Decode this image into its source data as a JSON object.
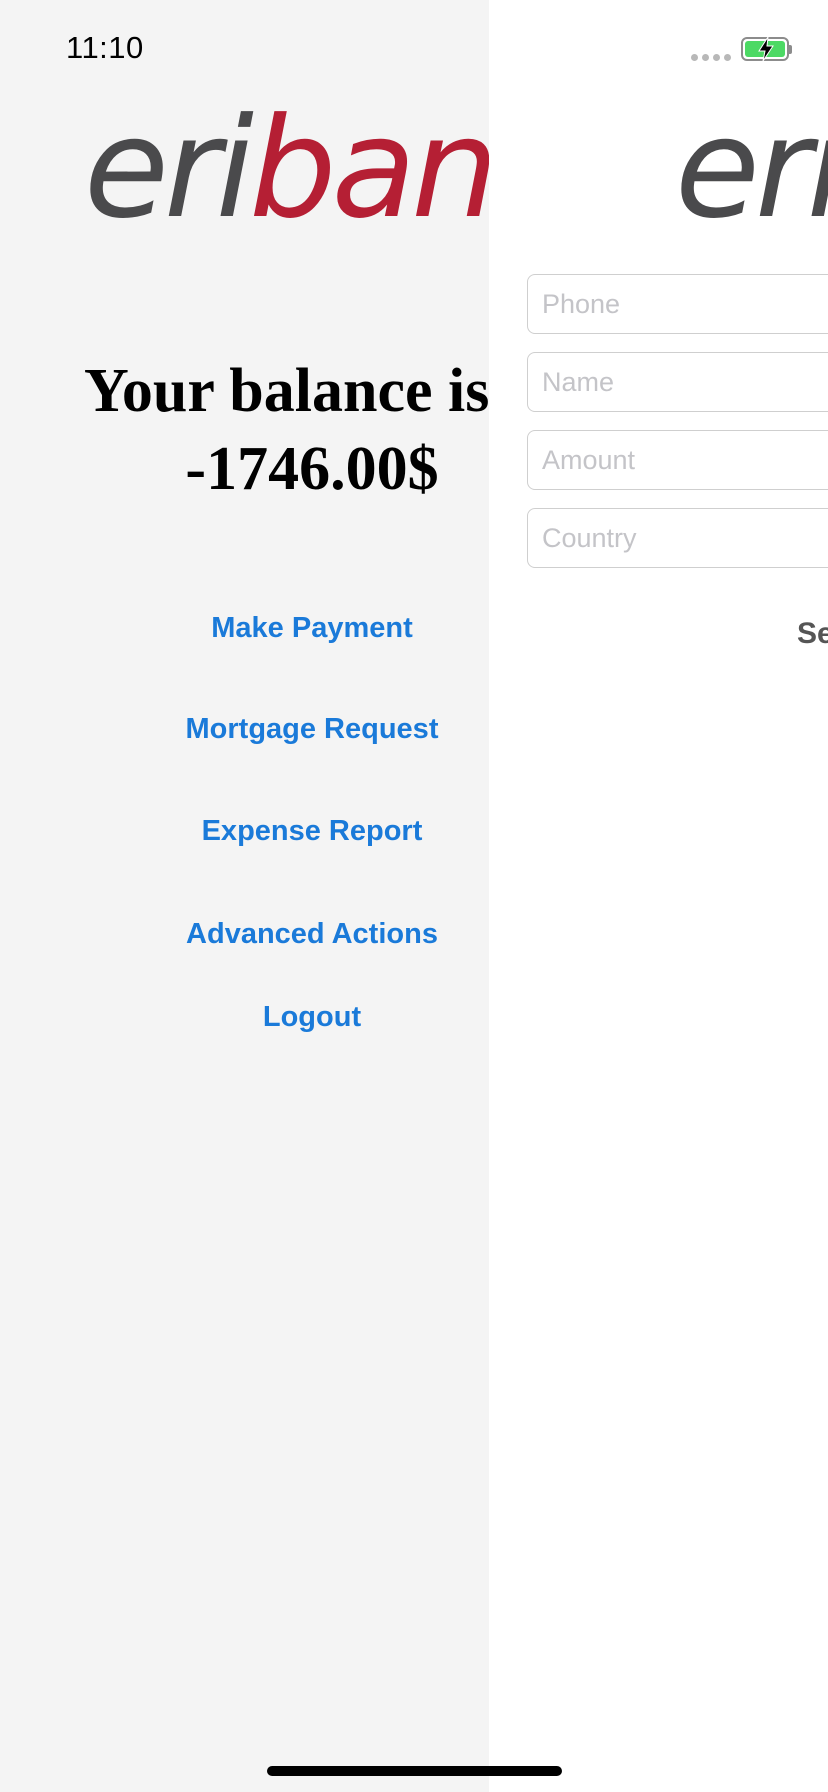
{
  "status_bar": {
    "time": "11:10",
    "battery_state": "charging",
    "battery_color": "#4cd964"
  },
  "brand": {
    "logo_part1": "eri",
    "logo_part2": "bank",
    "logo_color_gray": "#4a4a4c",
    "logo_color_red": "#b51f34"
  },
  "home": {
    "balance_label": "Your balance is",
    "balance_value": "-1746.00$",
    "menu_items": [
      "Make Payment",
      "Mortgage Request",
      "Expense Report",
      "Advanced Actions",
      "Logout"
    ],
    "link_color": "#1a7ad9"
  },
  "payment_form": {
    "phone_placeholder": "Phone",
    "name_placeholder": "Name",
    "amount_placeholder": "Amount",
    "country_placeholder": "Country",
    "send_label": "Se"
  }
}
